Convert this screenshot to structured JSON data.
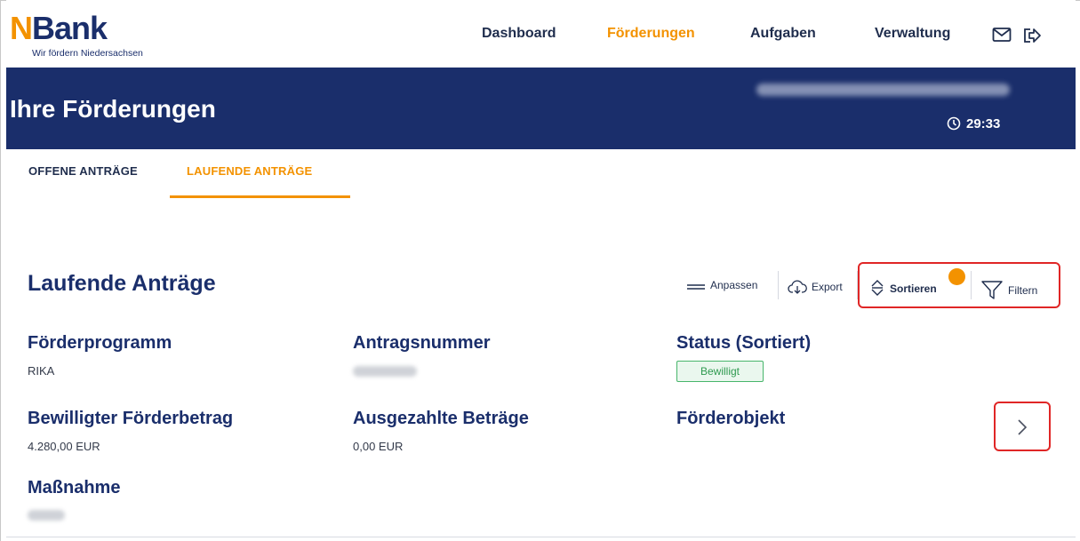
{
  "brand": {
    "logo_n": "N",
    "logo_rest": "Bank",
    "tagline": "Wir fördern Niedersachsen",
    "accent_color": "#f39200",
    "primary_color": "#1a2e6b"
  },
  "nav": {
    "items": [
      {
        "label": "Dashboard",
        "active": false
      },
      {
        "label": "Förderungen",
        "active": true
      },
      {
        "label": "Aufgaben",
        "active": false
      },
      {
        "label": "Verwaltung",
        "active": false
      }
    ],
    "icons": [
      "mail-icon",
      "logout-icon"
    ]
  },
  "banner": {
    "title": "Ihre Förderungen",
    "timer": "29:33"
  },
  "tabs": [
    {
      "label": "OFFENE ANTRÄGE",
      "active": false
    },
    {
      "label": "LAUFENDE ANTRÄGE",
      "active": true
    }
  ],
  "section": {
    "title": "Laufende Anträge",
    "tools": {
      "adjust": "Anpassen",
      "export": "Export",
      "sort": "Sortieren",
      "filter": "Filtern"
    }
  },
  "record": {
    "program_label": "Förderprogramm",
    "program_value": "RIKA",
    "application_label": "Antragsnummer",
    "status_label": "Status (Sortiert)",
    "status_value": "Bewilligt",
    "approved_label": "Bewilligter Förderbetrag",
    "approved_value": "4.280,00 EUR",
    "paid_label": "Ausgezahlte Beträge",
    "paid_value": "0,00 EUR",
    "object_label": "Förderobjekt",
    "measure_label": "Maßnahme"
  }
}
